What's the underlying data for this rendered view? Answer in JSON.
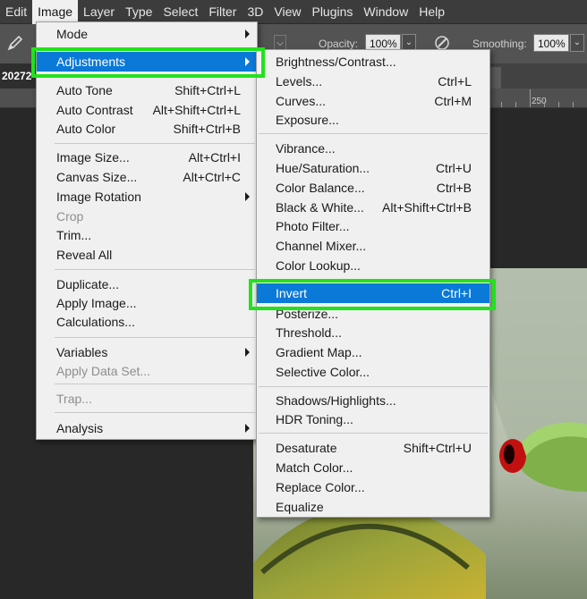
{
  "menubar": {
    "items": [
      {
        "label": "Edit"
      },
      {
        "label": "Image",
        "active": true
      },
      {
        "label": "Layer"
      },
      {
        "label": "Type"
      },
      {
        "label": "Select"
      },
      {
        "label": "Filter"
      },
      {
        "label": "3D"
      },
      {
        "label": "View"
      },
      {
        "label": "Plugins"
      },
      {
        "label": "Window"
      },
      {
        "label": "Help"
      }
    ]
  },
  "options_bar": {
    "opacity_label": "Opacity:",
    "opacity_value": "100%",
    "smoothing_label": "Smoothing:",
    "smoothing_value": "100%"
  },
  "document_tab": {
    "title": "20272"
  },
  "ruler": {
    "label": "250"
  },
  "image_menu": {
    "items": [
      {
        "label": "Mode",
        "shortcut": "",
        "submenu": true
      },
      {
        "label": "Adjustments",
        "shortcut": "",
        "submenu": true,
        "highlighted": true
      },
      {
        "label": "Auto Tone",
        "shortcut": "Shift+Ctrl+L"
      },
      {
        "label": "Auto Contrast",
        "shortcut": "Alt+Shift+Ctrl+L"
      },
      {
        "label": "Auto Color",
        "shortcut": "Shift+Ctrl+B"
      },
      {
        "label": "Image Size...",
        "shortcut": "Alt+Ctrl+I"
      },
      {
        "label": "Canvas Size...",
        "shortcut": "Alt+Ctrl+C"
      },
      {
        "label": "Image Rotation",
        "shortcut": "",
        "submenu": true
      },
      {
        "label": "Crop",
        "shortcut": "",
        "disabled": true
      },
      {
        "label": "Trim...",
        "shortcut": ""
      },
      {
        "label": "Reveal All",
        "shortcut": ""
      },
      {
        "label": "Duplicate...",
        "shortcut": ""
      },
      {
        "label": "Apply Image...",
        "shortcut": ""
      },
      {
        "label": "Calculations...",
        "shortcut": ""
      },
      {
        "label": "Variables",
        "shortcut": "",
        "submenu": true
      },
      {
        "label": "Apply Data Set...",
        "shortcut": "",
        "disabled": true
      },
      {
        "label": "Trap...",
        "shortcut": "",
        "disabled": true
      },
      {
        "label": "Analysis",
        "shortcut": "",
        "submenu": true
      }
    ]
  },
  "adjustments_menu": {
    "items": [
      {
        "label": "Brightness/Contrast...",
        "shortcut": ""
      },
      {
        "label": "Levels...",
        "shortcut": "Ctrl+L"
      },
      {
        "label": "Curves...",
        "shortcut": "Ctrl+M"
      },
      {
        "label": "Exposure...",
        "shortcut": ""
      },
      {
        "label": "Vibrance...",
        "shortcut": ""
      },
      {
        "label": "Hue/Saturation...",
        "shortcut": "Ctrl+U"
      },
      {
        "label": "Color Balance...",
        "shortcut": "Ctrl+B"
      },
      {
        "label": "Black & White...",
        "shortcut": "Alt+Shift+Ctrl+B"
      },
      {
        "label": "Photo Filter...",
        "shortcut": ""
      },
      {
        "label": "Channel Mixer...",
        "shortcut": ""
      },
      {
        "label": "Color Lookup...",
        "shortcut": ""
      },
      {
        "label": "Invert",
        "shortcut": "Ctrl+I",
        "highlighted": true
      },
      {
        "label": "Posterize...",
        "shortcut": ""
      },
      {
        "label": "Threshold...",
        "shortcut": ""
      },
      {
        "label": "Gradient Map...",
        "shortcut": ""
      },
      {
        "label": "Selective Color...",
        "shortcut": ""
      },
      {
        "label": "Shadows/Highlights...",
        "shortcut": ""
      },
      {
        "label": "HDR Toning...",
        "shortcut": ""
      },
      {
        "label": "Desaturate",
        "shortcut": "Shift+Ctrl+U"
      },
      {
        "label": "Match Color...",
        "shortcut": ""
      },
      {
        "label": "Replace Color...",
        "shortcut": ""
      },
      {
        "label": "Equalize",
        "shortcut": ""
      }
    ]
  },
  "colors": {
    "highlight": "#0a79d8",
    "annotation_box": "#21e21b"
  }
}
